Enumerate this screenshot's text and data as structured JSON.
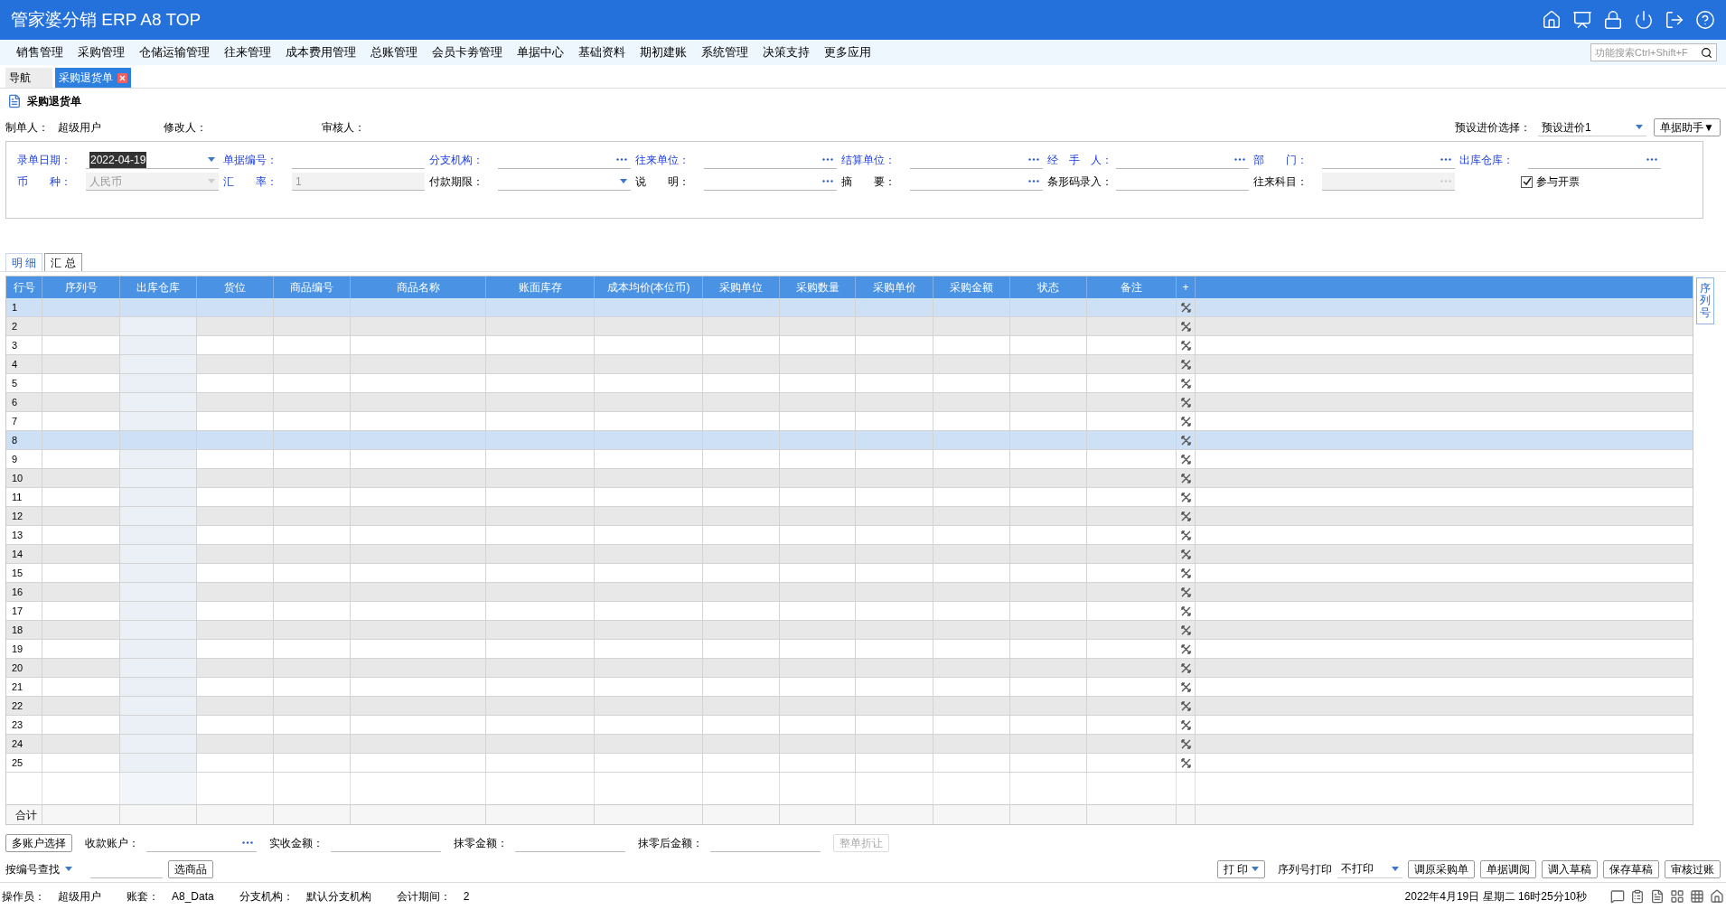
{
  "app_title": "管家婆分销 ERP A8 TOP",
  "menu": [
    "销售管理",
    "采购管理",
    "仓储运输管理",
    "往来管理",
    "成本费用管理",
    "总账管理",
    "会员卡劵管理",
    "单据中心",
    "基础资料",
    "期初建账",
    "系统管理",
    "决策支持",
    "更多应用"
  ],
  "search": {
    "placeholder": "功能搜索Ctrl+Shift+F"
  },
  "tabs": [
    {
      "label": "导航",
      "selected": false
    },
    {
      "label": "采购退货单",
      "selected": true
    }
  ],
  "page_title": "采购退货单",
  "meta": [
    {
      "label": "制单人：",
      "value": "超级用户"
    },
    {
      "label": "修改人："
    },
    {
      "label": "审核人："
    }
  ],
  "preset": {
    "label": "预设进价选择：",
    "value": "预设进价1"
  },
  "helper_button": "单据助手▼",
  "form_rows": [
    [
      {
        "label": "录单日期：",
        "kind": "dropdown",
        "required": true,
        "value": "2022-04-19",
        "disabled": false
      },
      {
        "label": "单据编号：",
        "kind": "text",
        "required": true,
        "disabled": false
      },
      {
        "label": "分支机构：",
        "kind": "lookup",
        "required": true,
        "disabled": false
      },
      {
        "label": "往来单位：",
        "kind": "lookup",
        "required": true,
        "disabled": false
      },
      {
        "label": "结算单位：",
        "kind": "lookup",
        "required": true,
        "disabled": false
      },
      {
        "label": "经　手　人：",
        "kind": "lookup",
        "required": true,
        "disabled": false
      },
      {
        "label": "部　　门：",
        "kind": "lookup",
        "required": true,
        "disabled": false
      },
      {
        "label": "出库仓库：",
        "kind": "lookup",
        "required": true,
        "disabled": false
      }
    ],
    [
      {
        "label": "币　　种：",
        "kind": "dropdown",
        "required": true,
        "value": "人民币",
        "disabled": true
      },
      {
        "label": "汇　　率：",
        "kind": "text",
        "required": true,
        "value": "1",
        "disabled": true
      },
      {
        "label": "付款期限：",
        "kind": "dropdown",
        "required": false,
        "disabled": false
      },
      {
        "label": "说　　明：",
        "kind": "lookup",
        "required": false,
        "disabled": false
      },
      {
        "label": "摘　　要：",
        "kind": "lookup",
        "required": false,
        "disabled": false
      },
      {
        "label": "条形码录入：",
        "kind": "text",
        "required": false,
        "disabled": false
      },
      {
        "label": "往来科目：",
        "kind": "lookup",
        "required": false,
        "disabled": true
      },
      {
        "label": "参与开票",
        "kind": "checkbox",
        "checked": true
      }
    ]
  ],
  "detail_tabs": [
    {
      "label": "明 细",
      "selected": true
    },
    {
      "label": "汇 总",
      "selected": false
    }
  ],
  "table": {
    "columns": [
      "行号",
      "序列号",
      "出库仓库",
      "货位",
      "商品编号",
      "商品名称",
      "账面库存",
      "成本均价(本位币)",
      "采购单位",
      "采购数量",
      "采购单价",
      "采购金额",
      "状态",
      "备注",
      "+"
    ],
    "rows": [
      {
        "no": "1",
        "selected": true
      },
      {
        "no": "2",
        "selected": false
      },
      {
        "no": "3",
        "selected": false
      },
      {
        "no": "4",
        "selected": false
      },
      {
        "no": "5",
        "selected": false
      },
      {
        "no": "6",
        "selected": false
      },
      {
        "no": "7",
        "selected": false
      },
      {
        "no": "8",
        "selected": true
      },
      {
        "no": "9",
        "selected": false
      },
      {
        "no": "10",
        "selected": false
      },
      {
        "no": "11",
        "selected": false
      },
      {
        "no": "12",
        "selected": false
      },
      {
        "no": "13",
        "selected": false
      },
      {
        "no": "14",
        "selected": false
      },
      {
        "no": "15",
        "selected": false
      },
      {
        "no": "16",
        "selected": false
      },
      {
        "no": "17",
        "selected": false
      },
      {
        "no": "18",
        "selected": false
      },
      {
        "no": "19",
        "selected": false
      },
      {
        "no": "20",
        "selected": false
      },
      {
        "no": "21",
        "selected": false
      },
      {
        "no": "22",
        "selected": false
      },
      {
        "no": "23",
        "selected": false
      },
      {
        "no": "24",
        "selected": false
      },
      {
        "no": "25",
        "selected": false
      }
    ],
    "total_label": "合计"
  },
  "side_tab": "序列号",
  "payment": {
    "button": "多账户选择",
    "fields": [
      {
        "label": "收款账户：",
        "kind": "lookup"
      },
      {
        "label": "实收金额：",
        "kind": "text"
      },
      {
        "label": "抹零金额：",
        "kind": "text"
      },
      {
        "label": "抹零后金额：",
        "kind": "text"
      }
    ],
    "discount_button": {
      "label": "整单折让",
      "disabled": true
    }
  },
  "actions": {
    "find_mode": "按编号查找",
    "pick_button": "选商品",
    "print_button": "打 印",
    "serial_print": {
      "label": "序列号打印",
      "value": "不打印"
    },
    "buttons": [
      "调原采购单",
      "单据调阅",
      "调入草稿",
      "保存草稿",
      "审核过账"
    ]
  },
  "status_bar": {
    "items": [
      {
        "label": "操作员：",
        "value": "超级用户"
      },
      {
        "label": "账套：",
        "value": "A8_Data"
      },
      {
        "label": "分支机构：",
        "value": "默认分支机构"
      },
      {
        "label": "会计期间：",
        "value": "2"
      }
    ],
    "datetime": "2022年4月19日 星期二 16时25分10秒"
  }
}
